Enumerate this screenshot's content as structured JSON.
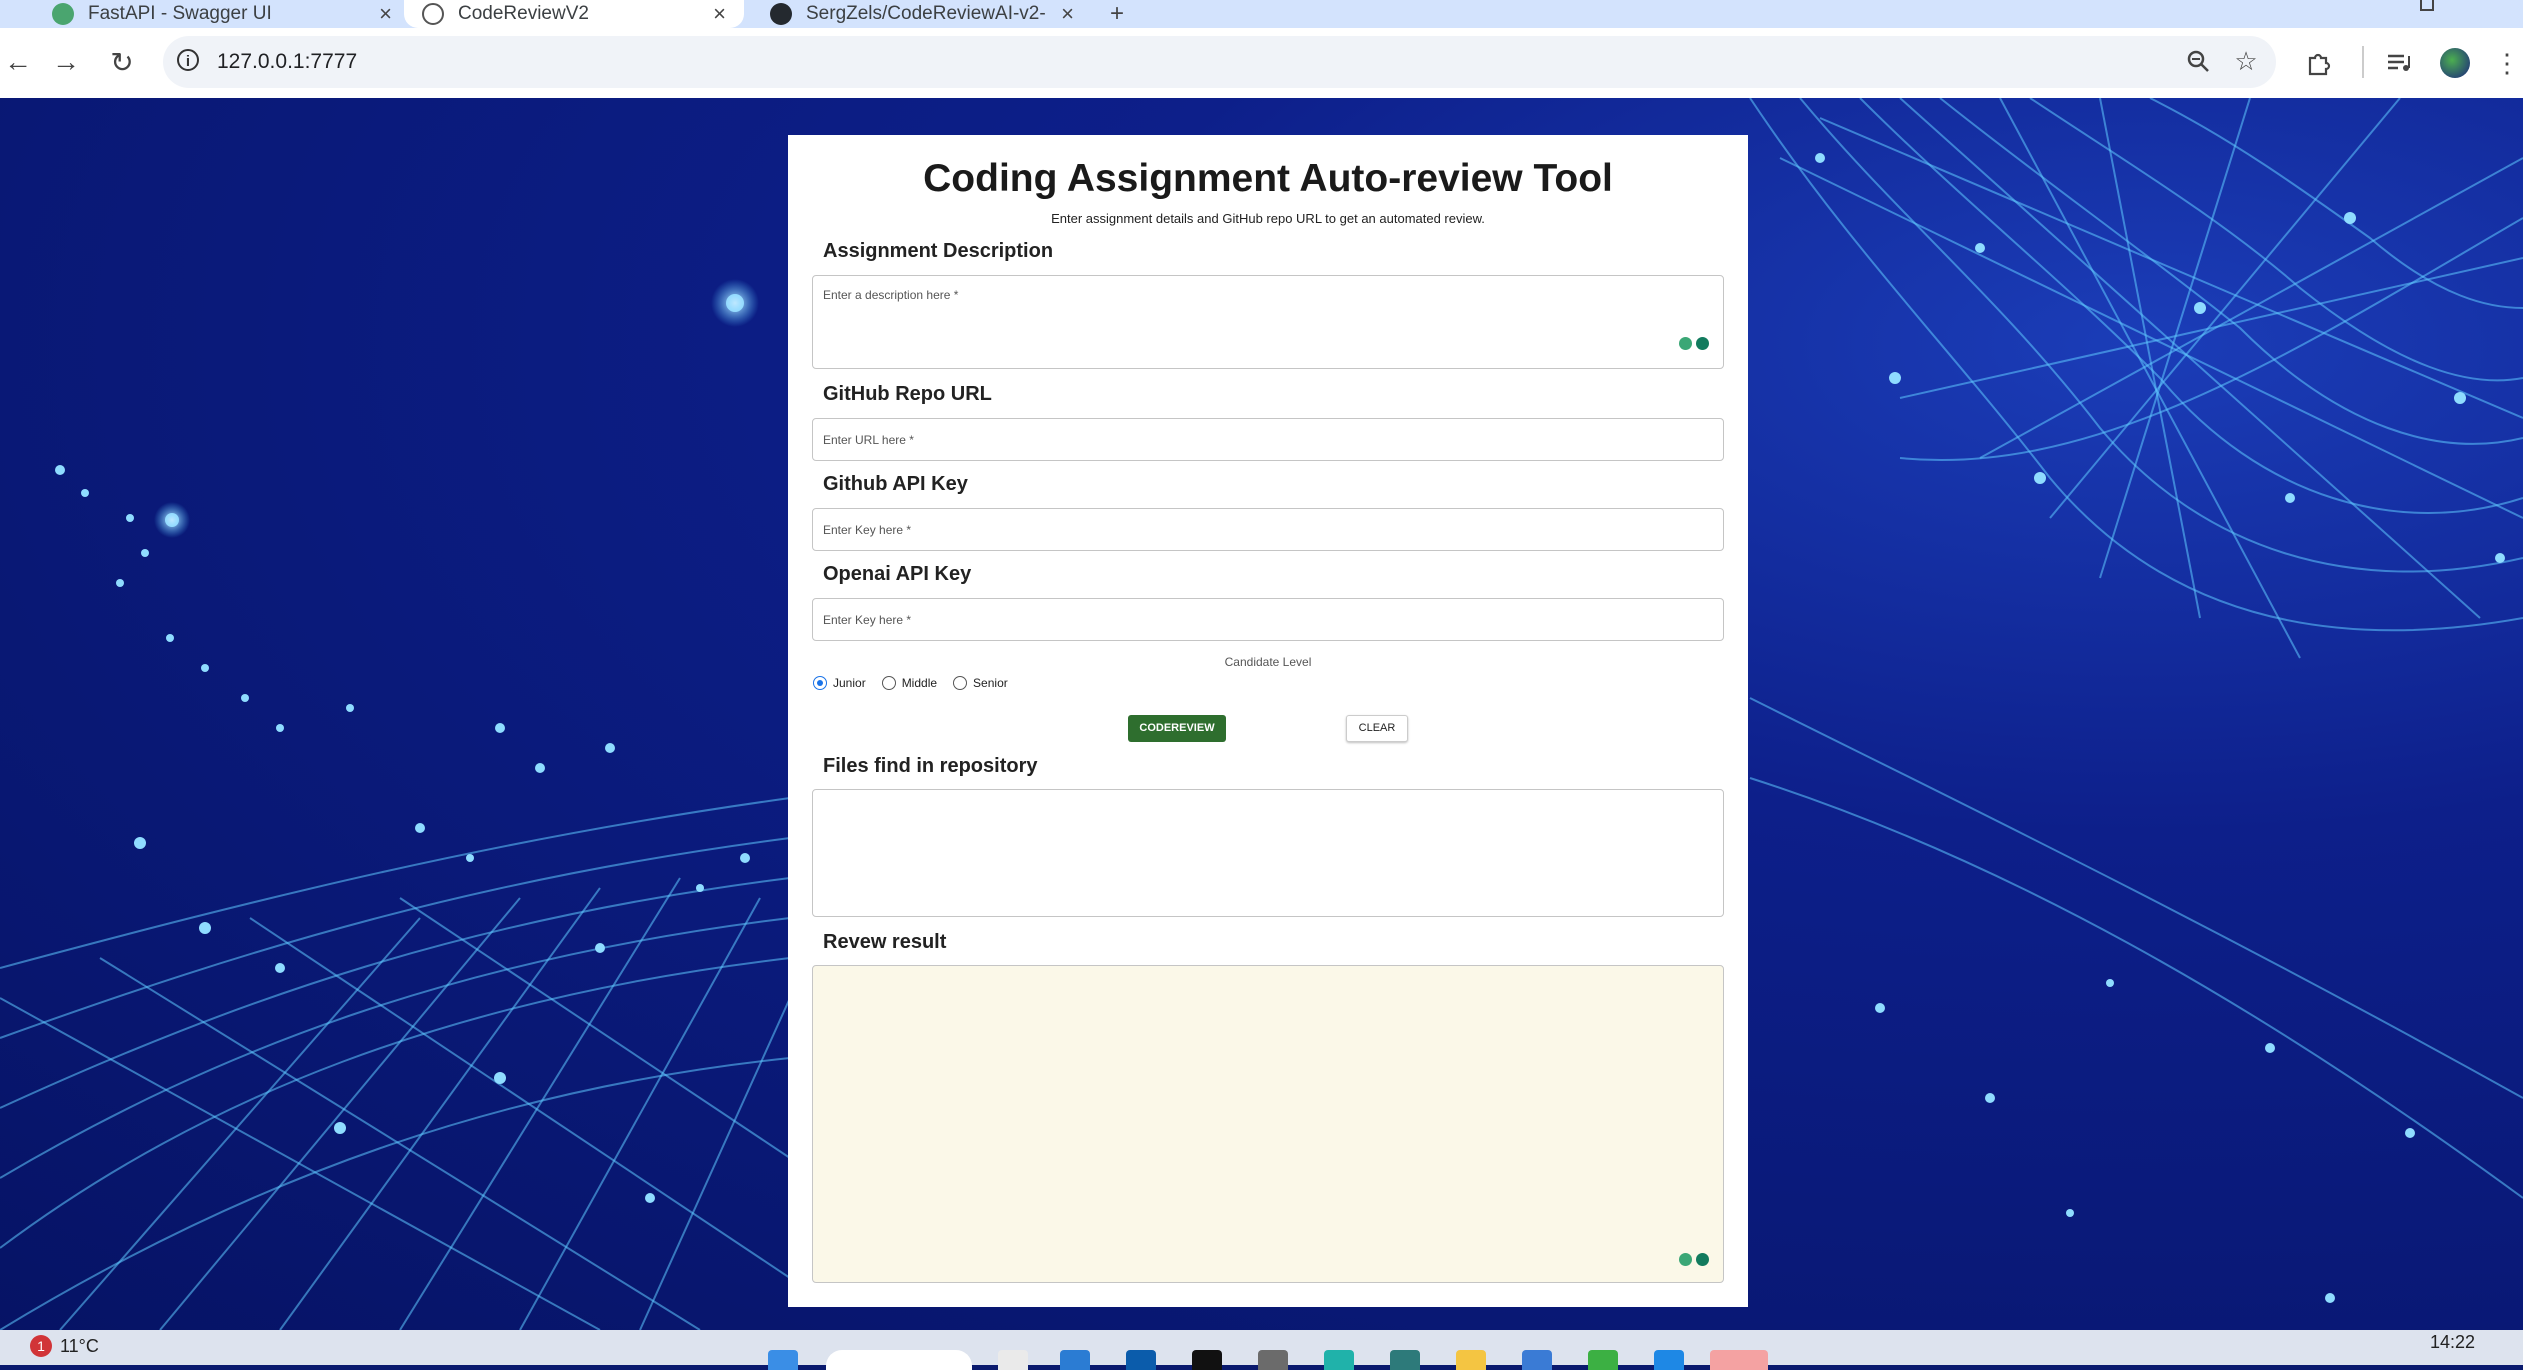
{
  "browser": {
    "tabs": [
      {
        "title": "FastAPI - Swagger UI",
        "active": false,
        "icon": "swagger-icon"
      },
      {
        "title": "CodeReviewV2",
        "active": true,
        "icon": "page-icon"
      },
      {
        "title": "SergZels/CodeReviewAI-v2-",
        "active": false,
        "icon": "github-icon"
      }
    ],
    "url": "127.0.0.1:7777"
  },
  "form": {
    "title": "Coding Assignment Auto-review Tool",
    "subtitle": "Enter assignment details and GitHub repo URL to get an automated review.",
    "assignment": {
      "label": "Assignment Description",
      "placeholder": "Enter a description here *"
    },
    "repo": {
      "label": "GitHub Repo URL",
      "placeholder": "Enter URL here *"
    },
    "github_key": {
      "label": "Github API Key",
      "placeholder": "Enter Key here *"
    },
    "openai_key": {
      "label": "Openai API Key",
      "placeholder": "Enter Key here *"
    },
    "candidate_level": {
      "label": "Candidate Level",
      "options": [
        "Junior",
        "Middle",
        "Senior"
      ],
      "selected": "Junior"
    },
    "buttons": {
      "review": "CODEREVIEW",
      "clear": "CLEAR"
    },
    "files": {
      "label": "Files find in repository",
      "value": ""
    },
    "result": {
      "label": "Revew result",
      "value": "",
      "background": "#fbf8e8"
    }
  },
  "taskbar": {
    "weather": {
      "temp": "11°C",
      "badge": "1"
    },
    "clock": "14:22"
  },
  "colors": {
    "review_button": "#2e6e2e",
    "radio_selected": "#1a73e8",
    "tabbar": "#d3e3fd"
  }
}
